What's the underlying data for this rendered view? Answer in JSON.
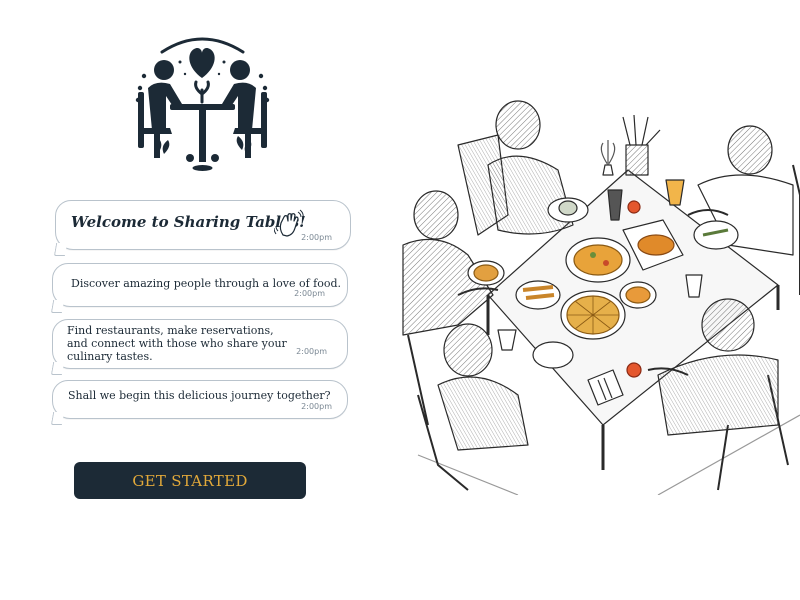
{
  "chat": {
    "messages": [
      {
        "text": "Welcome to Sharing Tables!",
        "time": "2:00pm"
      },
      {
        "text": "Discover amazing people through a love of food.",
        "time": "2:00pm"
      },
      {
        "text": "Find restaurants, make reservations, and connect with those who share your culinary tastes.",
        "time": "2:00pm"
      },
      {
        "text": "Shall we begin this delicious journey together?",
        "time": "2:00pm"
      }
    ]
  },
  "cta": {
    "label": "GET STARTED"
  },
  "icons": {
    "logo": "sharing-tables-logo-icon",
    "wave": "waving-hand-icon"
  },
  "colors": {
    "navy": "#1c2a36",
    "gold": "#e2a93a",
    "bubble_border": "#b9c3cc"
  }
}
